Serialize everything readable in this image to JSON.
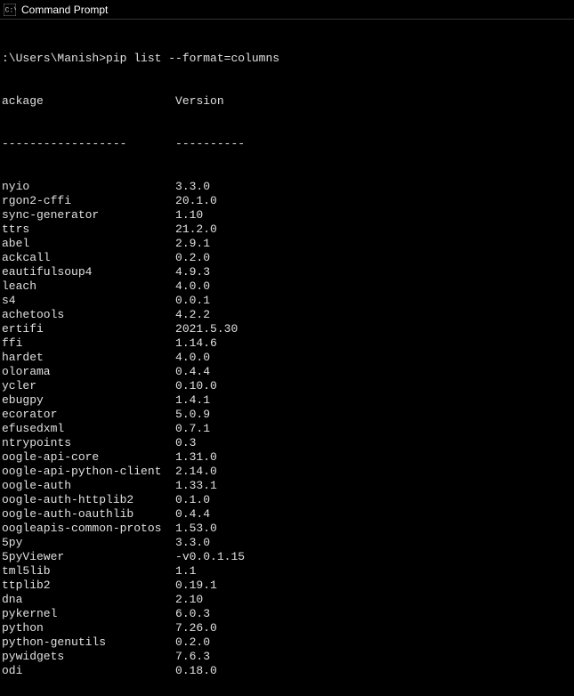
{
  "window": {
    "title": "Command Prompt"
  },
  "terminal": {
    "prompt": ":\\Users\\Manish>pip list --format=columns",
    "header_package": "ackage",
    "header_version": "Version",
    "divider_package": "------------------",
    "divider_version": "----------",
    "packages": [
      {
        "name": "nyio",
        "version": "3.3.0"
      },
      {
        "name": "rgon2-cffi",
        "version": "20.1.0"
      },
      {
        "name": "sync-generator",
        "version": "1.10"
      },
      {
        "name": "ttrs",
        "version": "21.2.0"
      },
      {
        "name": "abel",
        "version": "2.9.1"
      },
      {
        "name": "ackcall",
        "version": "0.2.0"
      },
      {
        "name": "eautifulsoup4",
        "version": "4.9.3"
      },
      {
        "name": "leach",
        "version": "4.0.0"
      },
      {
        "name": "s4",
        "version": "0.0.1"
      },
      {
        "name": "achetools",
        "version": "4.2.2"
      },
      {
        "name": "ertifi",
        "version": "2021.5.30"
      },
      {
        "name": "ffi",
        "version": "1.14.6"
      },
      {
        "name": "hardet",
        "version": "4.0.0"
      },
      {
        "name": "olorama",
        "version": "0.4.4"
      },
      {
        "name": "ycler",
        "version": "0.10.0"
      },
      {
        "name": "ebugpy",
        "version": "1.4.1"
      },
      {
        "name": "ecorator",
        "version": "5.0.9"
      },
      {
        "name": "efusedxml",
        "version": "0.7.1"
      },
      {
        "name": "ntrypoints",
        "version": "0.3"
      },
      {
        "name": "oogle-api-core",
        "version": "1.31.0"
      },
      {
        "name": "oogle-api-python-client",
        "version": "2.14.0"
      },
      {
        "name": "oogle-auth",
        "version": "1.33.1"
      },
      {
        "name": "oogle-auth-httplib2",
        "version": "0.1.0"
      },
      {
        "name": "oogle-auth-oauthlib",
        "version": "0.4.4"
      },
      {
        "name": "oogleapis-common-protos",
        "version": "1.53.0"
      },
      {
        "name": "5py",
        "version": "3.3.0"
      },
      {
        "name": "5pyViewer",
        "version": "-v0.0.1.15"
      },
      {
        "name": "tml5lib",
        "version": "1.1"
      },
      {
        "name": "ttplib2",
        "version": "0.19.1"
      },
      {
        "name": "dna",
        "version": "2.10"
      },
      {
        "name": "pykernel",
        "version": "6.0.3"
      },
      {
        "name": "python",
        "version": "7.26.0"
      },
      {
        "name": "python-genutils",
        "version": "0.2.0"
      },
      {
        "name": "pywidgets",
        "version": "7.6.3"
      },
      {
        "name": "odi",
        "version": "0.18.0"
      }
    ]
  }
}
